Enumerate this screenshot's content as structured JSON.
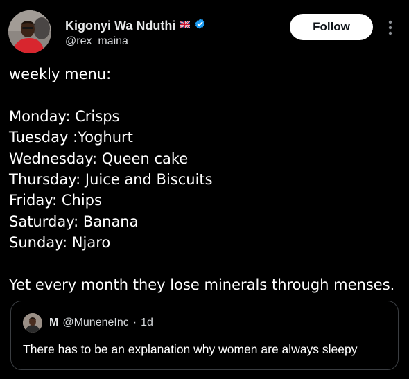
{
  "author": {
    "display_name": "Kigonyi Wa Nduthi",
    "flag_icon": "flag-icon",
    "verified_icon": "verified-badge-icon",
    "verified_color": "#1d9bf0",
    "handle": "@rex_maina"
  },
  "actions": {
    "follow_label": "Follow",
    "more_icon": "more-vertical-icon"
  },
  "tweet": {
    "lines": [
      "weekly menu:",
      "",
      "Monday: Crisps",
      "Tuesday :Yoghurt",
      "Wednesday: Queen cake",
      "Thursday: Juice and Biscuits",
      "Friday: Chips",
      "Saturday: Banana",
      "Sunday: Njaro",
      "",
      "Yet every month they lose minerals through menses."
    ]
  },
  "quoted": {
    "name": "M",
    "handle": "@MuneneInc",
    "separator": "·",
    "time": "1d",
    "text": "There has to be an explanation why women are always sleepy"
  }
}
